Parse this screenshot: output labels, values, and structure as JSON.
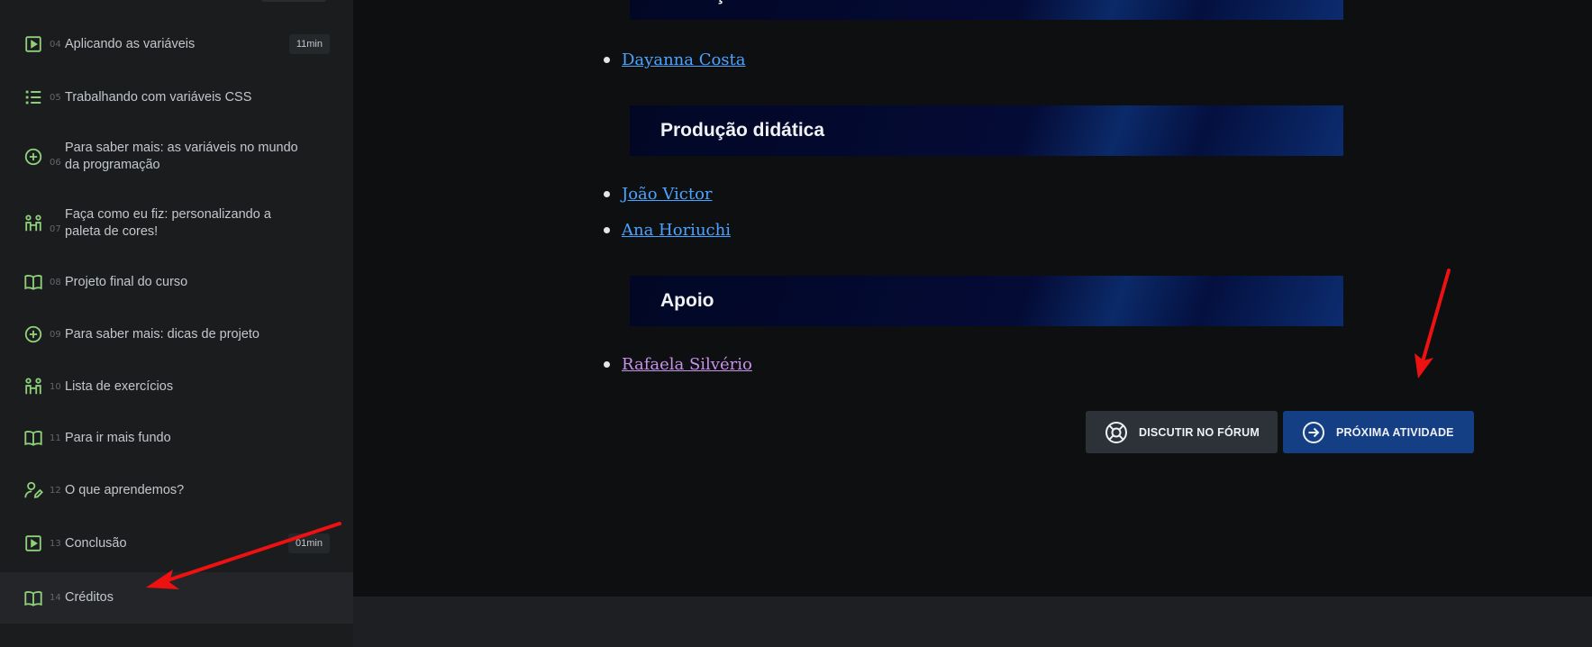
{
  "sidebar": {
    "items": [
      {
        "num": "04",
        "label": "Aplicando as variáveis",
        "duration": "11min",
        "icon": "play-icon"
      },
      {
        "num": "05",
        "label": "Trabalhando com variáveis CSS",
        "icon": "list-icon"
      },
      {
        "num": "06",
        "label": "Para saber mais: as variáveis no mundo da programação",
        "icon": "plus-circle-icon"
      },
      {
        "num": "07",
        "label": "Faça como eu fiz: personalizando a paleta de cores!",
        "icon": "people-icon"
      },
      {
        "num": "08",
        "label": "Projeto final do curso",
        "icon": "book-icon"
      },
      {
        "num": "09",
        "label": "Para saber mais: dicas de projeto",
        "icon": "plus-circle-icon"
      },
      {
        "num": "10",
        "label": "Lista de exercícios",
        "icon": "people-icon"
      },
      {
        "num": "11",
        "label": "Para ir mais fundo",
        "icon": "book-icon"
      },
      {
        "num": "12",
        "label": "O que aprendemos?",
        "icon": "user-edit-icon"
      },
      {
        "num": "13",
        "label": "Conclusão",
        "duration": "01min",
        "icon": "play-icon"
      },
      {
        "num": "14",
        "label": "Créditos",
        "icon": "book-icon",
        "active": true
      }
    ]
  },
  "content": {
    "sections": [
      {
        "title": "Produção audiovisual",
        "people": [
          "Dayanna Costa"
        ]
      },
      {
        "title": "Produção didática",
        "people": [
          "João Victor",
          "Ana Horiuchi"
        ]
      },
      {
        "title": "Apoio",
        "people": [
          "Rafaela Silvério"
        ]
      }
    ]
  },
  "actions": {
    "forum_label": "DISCUTIR NO FÓRUM",
    "next_label": "PRÓXIMA ATIVIDADE"
  },
  "colors": {
    "icon_green": "#8fd07a",
    "link_blue": "#4aa3ff",
    "link_visited": "#c792ea",
    "arrow_red": "#ee1111",
    "primary_button": "#153f84"
  }
}
